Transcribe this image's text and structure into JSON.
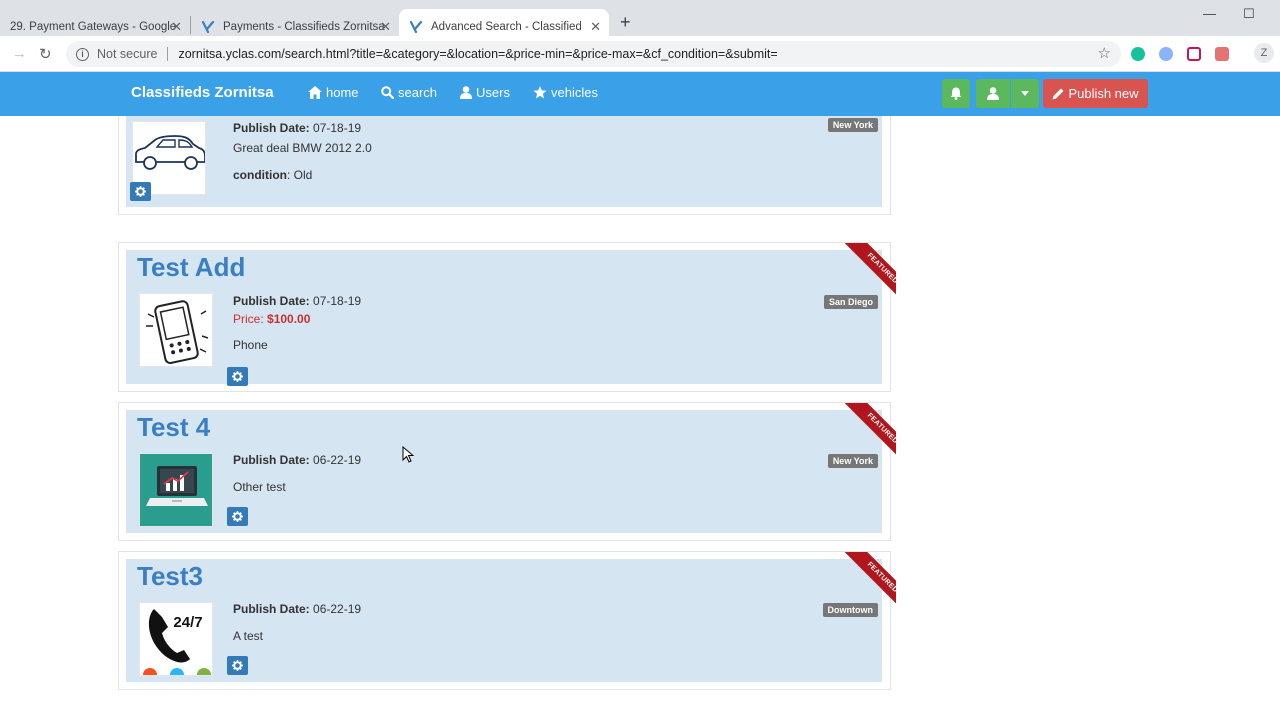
{
  "browser": {
    "tabs": [
      {
        "title": "29. Payment Gateways - Google"
      },
      {
        "title": "Payments - Classifieds Zornitsa"
      },
      {
        "title": "Advanced Search - Classifieds Zo"
      }
    ],
    "security_label": "Not secure",
    "url": "zornitsa.yclas.com/search.html?title=&category=&location=&price-min=&price-max=&cf_condition=&submit=",
    "profile_initial": "Z"
  },
  "site": {
    "brand": "Classifieds Zornitsa",
    "nav": [
      {
        "label": "home",
        "icon": "home-icon"
      },
      {
        "label": "search",
        "icon": "search-icon"
      },
      {
        "label": "Users",
        "icon": "user-icon"
      },
      {
        "label": "vehicles",
        "icon": "star-icon"
      }
    ],
    "publish_label": "Publish new",
    "colors": {
      "navbar": "#3aa0e8",
      "publish": "#d9534f",
      "green": "#5cb85c",
      "ribbon": "#b0161b"
    }
  },
  "listings": [
    {
      "title": "",
      "publish_label": "Publish Date:",
      "publish_date": "07-18-19",
      "description": "Great deal BMW 2012 2.0",
      "condition_label": "condition",
      "condition_value": "Old",
      "location": "New York",
      "image": "car-icon"
    },
    {
      "title": "Test Add",
      "publish_label": "Publish Date:",
      "publish_date": "07-18-19",
      "price_label": "Price:",
      "price_value": "$100.00",
      "description": "Phone",
      "location": "San Diego",
      "ribbon": "FEATURED",
      "image": "phone-icon"
    },
    {
      "title": "Test 4",
      "publish_label": "Publish Date:",
      "publish_date": "06-22-19",
      "description": "Other test",
      "location": "New York",
      "ribbon": "FEATURED",
      "image": "laptop-icon"
    },
    {
      "title": "Test3",
      "publish_label": "Publish Date:",
      "publish_date": "06-22-19",
      "description": "A test",
      "location": "Downtown",
      "ribbon": "FEATURED",
      "image": "support-24-7-icon",
      "image_text": "24/7"
    }
  ]
}
